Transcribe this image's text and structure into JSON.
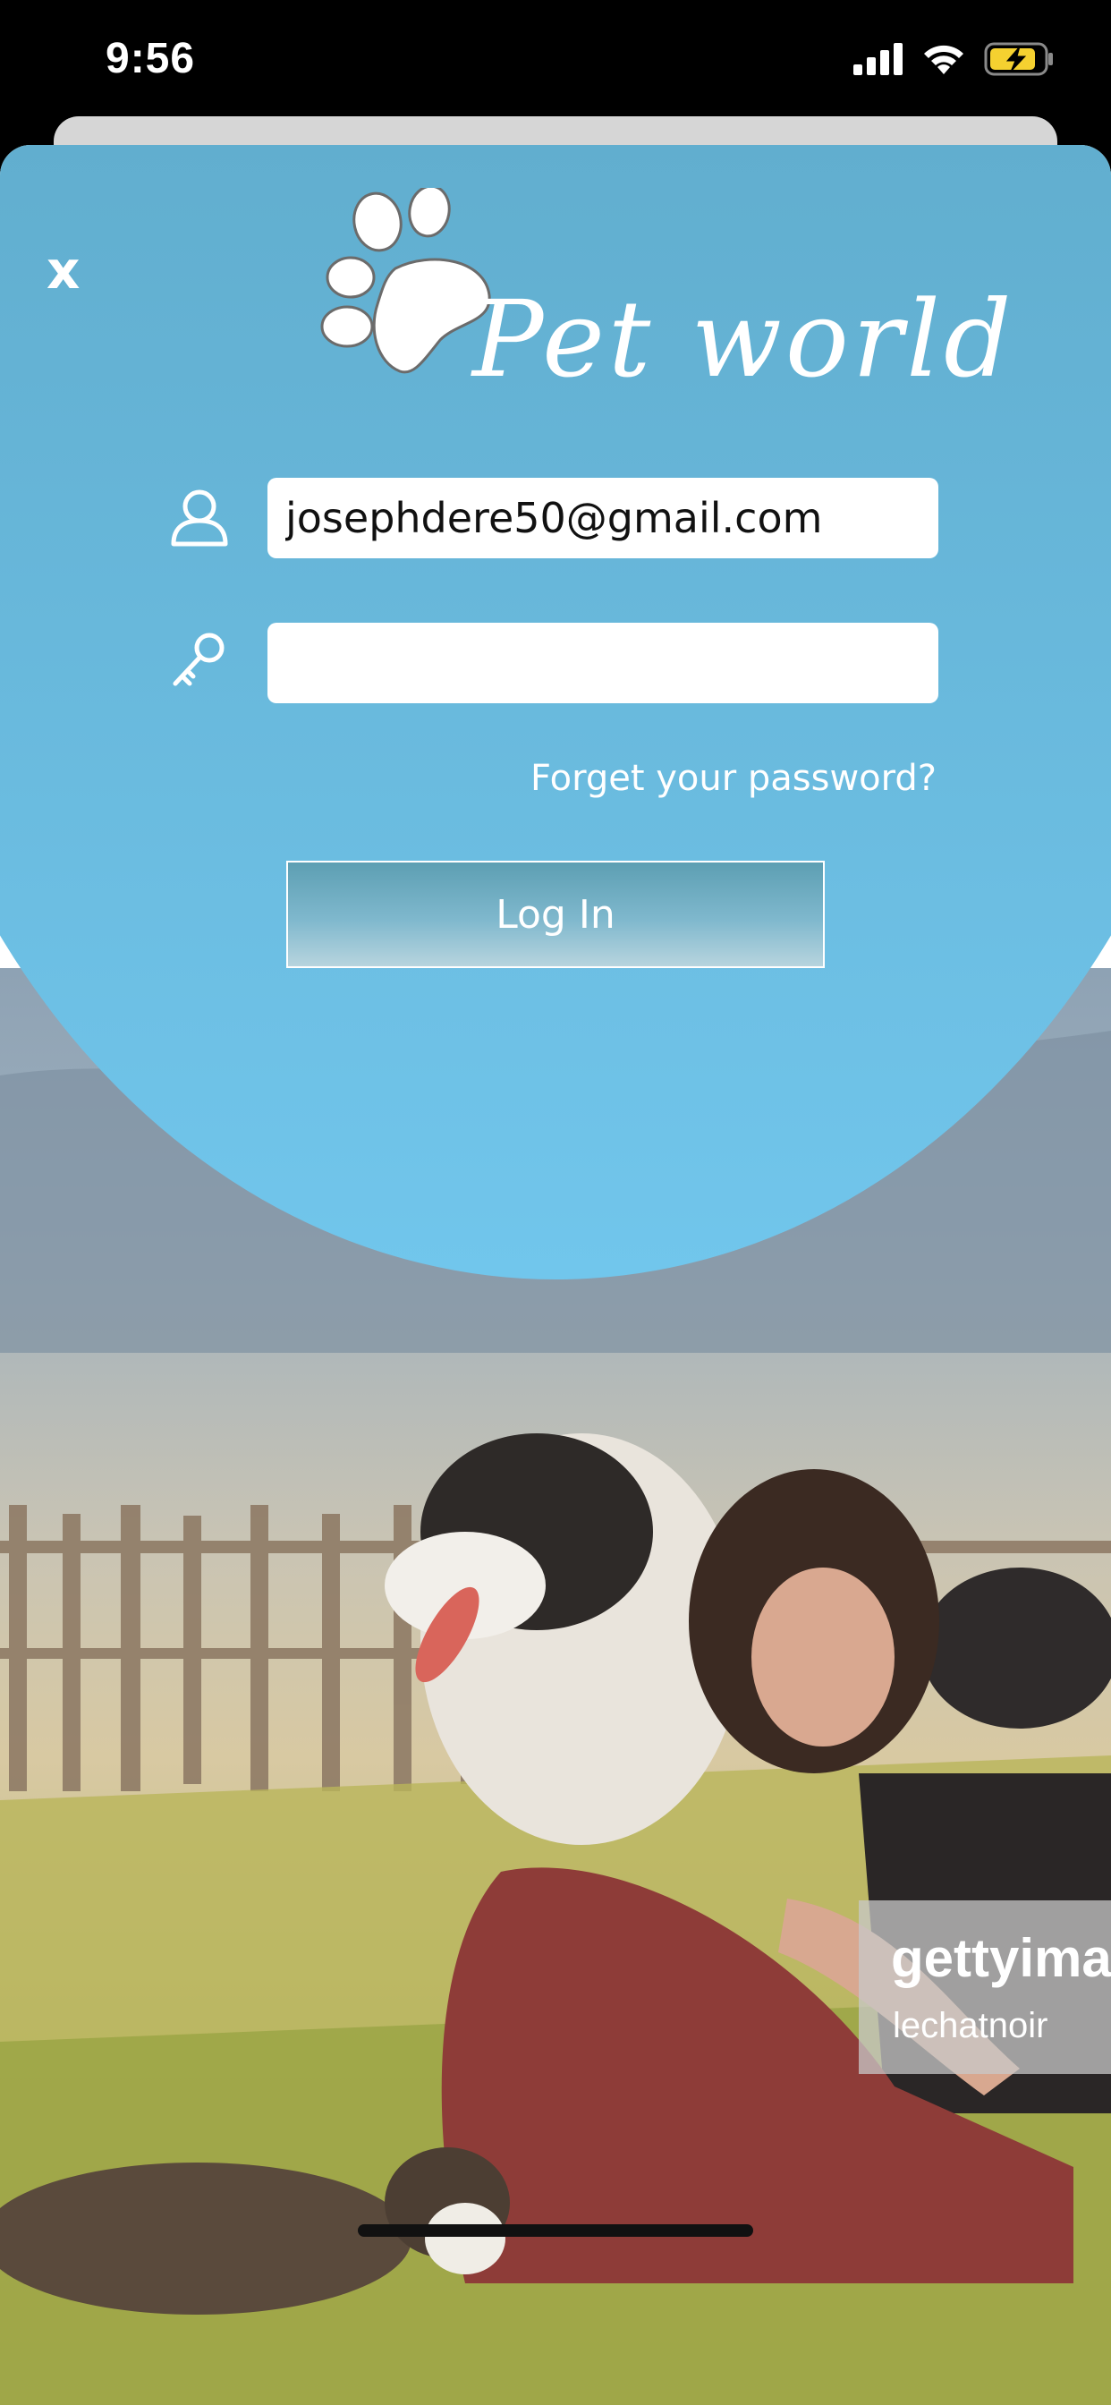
{
  "status_bar": {
    "time": "9:56",
    "icons": [
      "signal-icon",
      "wifi-icon",
      "battery-charging-icon"
    ]
  },
  "app": {
    "close_label": "x",
    "logo_text": "Pet world",
    "email_value": "josephdere50@gmail.com",
    "email_placeholder": "",
    "password_value": "",
    "password_placeholder": "",
    "forgot_password_label": "Forget your password?",
    "login_label": "Log In"
  },
  "photo_watermark": {
    "brand": "gettyima",
    "credit": "lechatnoir"
  },
  "colors": {
    "panel_top": "#5aa5c2",
    "panel_bottom": "#71c6ec",
    "text": "#ffffff",
    "battery": "#f5d130"
  }
}
